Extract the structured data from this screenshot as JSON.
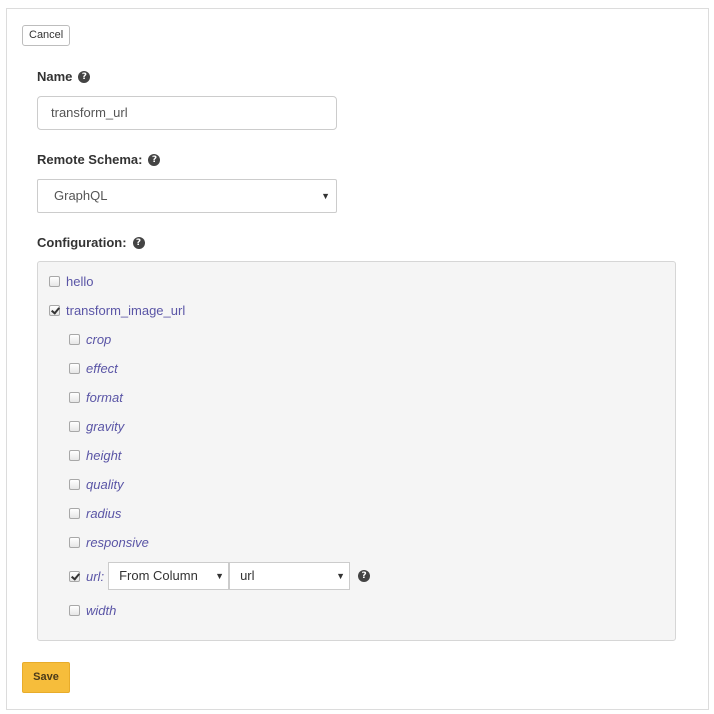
{
  "toolbar": {
    "cancel_label": "Cancel"
  },
  "name_field": {
    "label": "Name",
    "value": "transform_url"
  },
  "remote_schema": {
    "label": "Remote Schema:",
    "selected": "GraphQL"
  },
  "configuration": {
    "label": "Configuration:",
    "fields": [
      {
        "name": "hello",
        "checked": false
      },
      {
        "name": "transform_image_url",
        "checked": true
      }
    ],
    "arguments": [
      {
        "name": "crop",
        "checked": false
      },
      {
        "name": "effect",
        "checked": false
      },
      {
        "name": "format",
        "checked": false
      },
      {
        "name": "gravity",
        "checked": false
      },
      {
        "name": "height",
        "checked": false
      },
      {
        "name": "quality",
        "checked": false
      },
      {
        "name": "radius",
        "checked": false
      },
      {
        "name": "responsive",
        "checked": false
      },
      {
        "name": "url:",
        "checked": true,
        "source": "From Column",
        "column": "url"
      },
      {
        "name": "width",
        "checked": false
      }
    ]
  },
  "footer": {
    "save_label": "Save"
  },
  "colors": {
    "accent": "#f6bd3b",
    "field_text": "#5a55a6"
  },
  "icons": {
    "help": "question-circle-icon",
    "dropdown": "caret-down-icon"
  }
}
